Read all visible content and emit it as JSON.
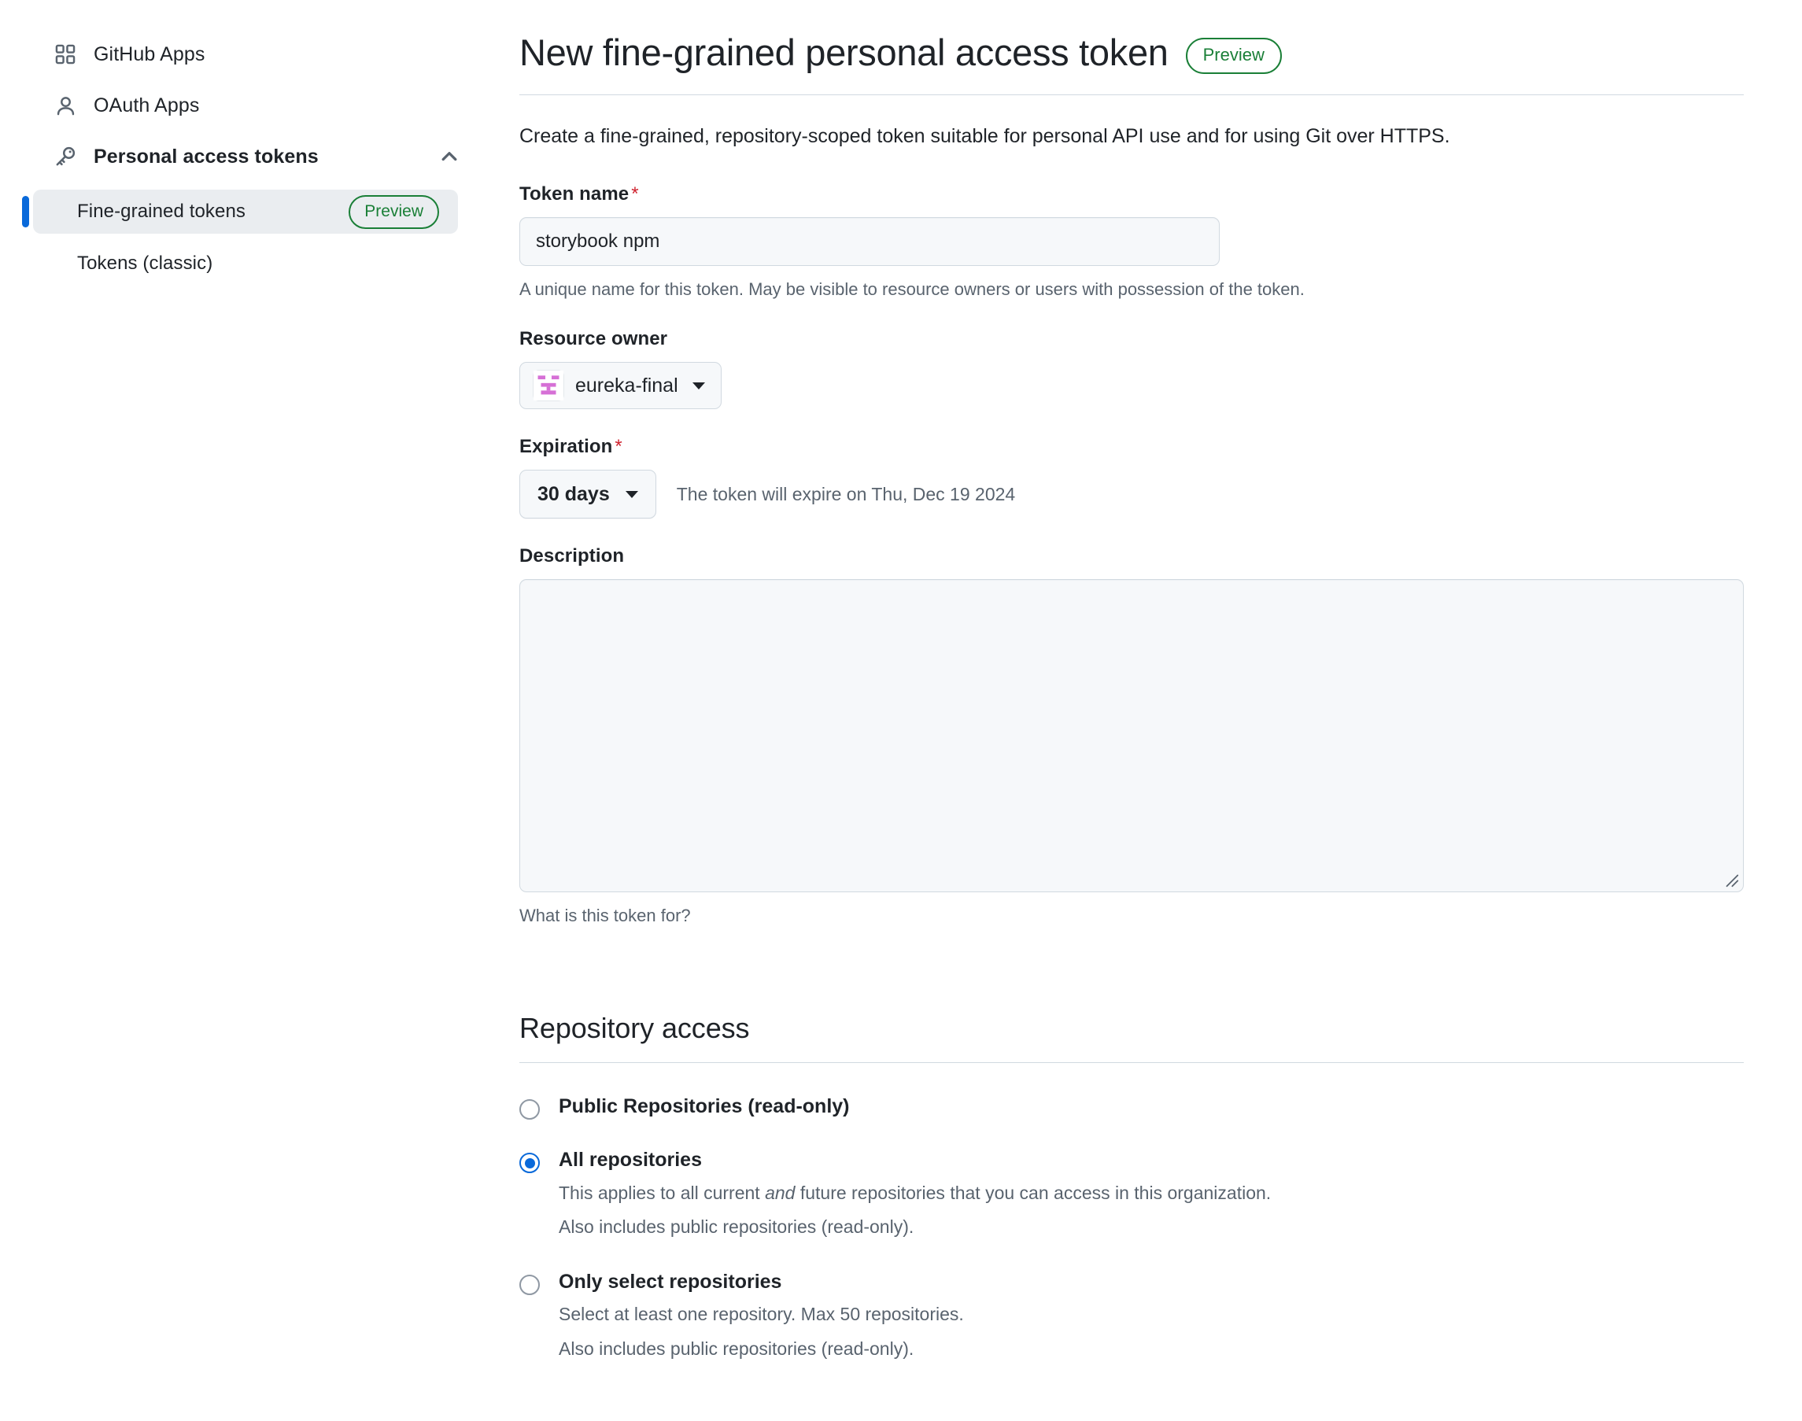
{
  "sidebar": {
    "items": [
      {
        "label": "GitHub Apps",
        "icon": "apps-grid-icon"
      },
      {
        "label": "OAuth Apps",
        "icon": "person-icon"
      },
      {
        "label": "Personal access tokens",
        "icon": "key-icon",
        "chevron": "chevron-up-icon",
        "expanded": true
      }
    ],
    "sub_items": [
      {
        "label": "Fine-grained tokens",
        "badge": "Preview",
        "active": true
      },
      {
        "label": "Tokens (classic)",
        "badge": "",
        "active": false
      }
    ]
  },
  "header": {
    "title": "New fine-grained personal access token",
    "badge": "Preview",
    "intro": "Create a fine-grained, repository-scoped token suitable for personal API use and for using Git over HTTPS."
  },
  "form": {
    "token_name": {
      "label": "Token name",
      "required_mark": "*",
      "value": "storybook npm",
      "placeholder": "",
      "help": "A unique name for this token. May be visible to resource owners or users with possession of the token."
    },
    "resource_owner": {
      "label": "Resource owner",
      "value": "eureka-final"
    },
    "expiration": {
      "label": "Expiration",
      "required_mark": "*",
      "value": "30 days",
      "note": "The token will expire on Thu, Dec 19 2024"
    },
    "description": {
      "label": "Description",
      "value": "",
      "help": "What is this token for?"
    }
  },
  "repository_access": {
    "title": "Repository access",
    "options": [
      {
        "label": "Public Repositories (read-only)",
        "selected": false,
        "desc_line1": "",
        "desc_line2": ""
      },
      {
        "label": "All repositories",
        "selected": true,
        "desc_pre": "This applies to all current ",
        "desc_em": "and",
        "desc_post": " future repositories that you can access in this organization.",
        "desc_line2": "Also includes public repositories (read-only)."
      },
      {
        "label": "Only select repositories",
        "selected": false,
        "desc_line1": "Select at least one repository. Max 50 repositories.",
        "desc_line2": "Also includes public repositories (read-only)."
      }
    ]
  },
  "colors": {
    "accent": "#0969da",
    "success": "#1a7f37",
    "danger": "#cf222e",
    "muted": "#59636e",
    "border": "#d1d9e0",
    "surface": "#f6f8fa",
    "active_bg": "#eaedf0",
    "avatar": "#d670d6"
  }
}
